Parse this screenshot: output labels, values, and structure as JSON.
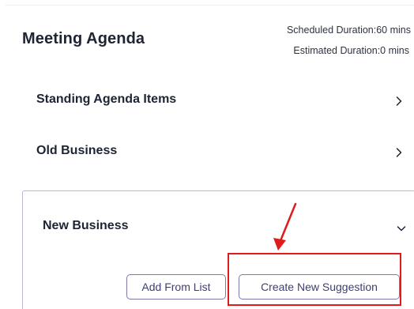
{
  "agenda": {
    "title": "Meeting Agenda",
    "scheduled_duration": "Scheduled Duration:60 mins",
    "estimated_duration": "Estimated Duration:0 mins"
  },
  "sections": [
    {
      "label": "Standing Agenda Items",
      "icon": "chevron-right-icon",
      "expanded": false
    },
    {
      "label": "Old Business",
      "icon": "chevron-right-icon",
      "expanded": false
    },
    {
      "label": "New Business",
      "icon": "chevron-down-icon",
      "expanded": true
    }
  ],
  "new_business": {
    "add_from_list_label": "Add From List",
    "create_suggestion_label": "Create New Suggestion"
  },
  "annotation": {
    "color": "#e01b1b",
    "icon": "red-arrow-icon"
  },
  "colors": {
    "panel_border": "#b9b7d6",
    "button_border": "#7c7aa8",
    "button_text": "#3f3e71"
  }
}
